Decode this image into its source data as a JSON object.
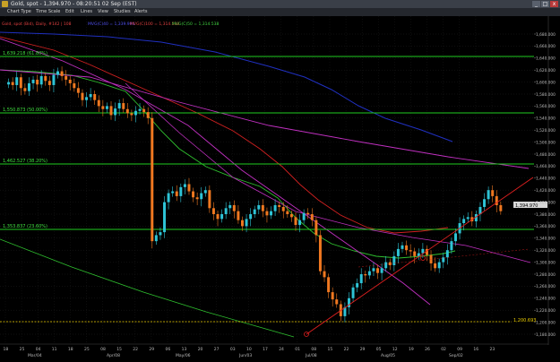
{
  "window": {
    "title": "Gold, spot - 1,394.970 - 08:20:51 02 Sep (EST)",
    "buttons": {
      "minimize": "_",
      "maximize": "□",
      "close": "x"
    }
  },
  "menu": [
    "Chart Type",
    "Time Scale",
    "Edit",
    "Lines",
    "View",
    "Studies",
    "Alerts"
  ],
  "legend": {
    "symbol": "Gold, spot (Bid), Daily, #142 | 108",
    "ma1": "MVG(C)40 = 1,339.994",
    "ma2": "MVG(C)100 = 1,314.538",
    "ma3": "MVG(C)50 = 1,314.538"
  },
  "colors": {
    "background": "#000000",
    "up": "#2ec4d6",
    "down": "#f07820",
    "fib": "#1fcc1f",
    "trend": "#e02020",
    "ma_red": "#d02020",
    "ma_green": "#2fc02f",
    "ma_blue": "#2030c0",
    "ma_magenta": "#c030c0",
    "yellow": "#f0d000"
  },
  "fib_labels": [
    "1,639.218 (61.80%)",
    "1,550.873 (50.00%)",
    "1,462.527 (38.20%)",
    "1,353.837 (23.60%)"
  ],
  "price_labels": {
    "current": "1,394.970",
    "yellow": "1,200.693"
  },
  "chart_data": {
    "type": "candlestick",
    "symbol": "Gold, spot",
    "y_ticks": [
      "1,680.000",
      "1,660.000",
      "1,640.000",
      "1,620.000",
      "1,600.000",
      "1,580.000",
      "1,560.000",
      "1,540.000",
      "1,520.000",
      "1,500.000",
      "1,480.000",
      "1,460.000",
      "1,440.000",
      "1,420.000",
      "1,400.000",
      "1,380.000",
      "1,360.000",
      "1,340.000",
      "1,320.000",
      "1,300.000",
      "1,280.000",
      "1,260.000",
      "1,240.000",
      "1,220.000",
      "1,200.000",
      "1,180.000"
    ],
    "x_ticks_days": [
      "18",
      "25",
      "04",
      "11",
      "18",
      "25",
      "08",
      "15",
      "22",
      "29",
      "06",
      "13",
      "20",
      "27",
      "03",
      "10",
      "17",
      "24",
      "01",
      "08",
      "15",
      "22",
      "29",
      "05",
      "12",
      "19",
      "26",
      "02",
      "09",
      "16",
      "23"
    ],
    "x_ticks_months": [
      "Mar/04",
      "Apr/08",
      "May/06",
      "Jun/03",
      "Jul/08",
      "Aug/05",
      "Sep/02"
    ],
    "ylim": [
      1170,
      1690
    ],
    "fib_levels": [
      1639.218,
      1550.873,
      1462.527,
      1353.837
    ],
    "current_price": 1394.97,
    "support_level": 1200.693,
    "closes": [
      1600,
      1595,
      1608,
      1590,
      1585,
      1598,
      1604,
      1596,
      1610,
      1602,
      1595,
      1612,
      1618,
      1610,
      1604,
      1598,
      1590,
      1582,
      1570,
      1575,
      1580,
      1570,
      1560,
      1555,
      1560,
      1545,
      1556,
      1565,
      1555,
      1548,
      1545,
      1552,
      1555,
      1550,
      1540,
      1335,
      1345,
      1350,
      1400,
      1415,
      1418,
      1410,
      1425,
      1430,
      1418,
      1408,
      1405,
      1415,
      1420,
      1390,
      1380,
      1372,
      1380,
      1390,
      1395,
      1385,
      1370,
      1360,
      1372,
      1380,
      1388,
      1395,
      1385,
      1378,
      1385,
      1395,
      1392,
      1385,
      1380,
      1375,
      1362,
      1370,
      1382,
      1380,
      1370,
      1345,
      1285,
      1275,
      1250,
      1238,
      1230,
      1210,
      1225,
      1240,
      1258,
      1265,
      1280,
      1278,
      1285,
      1290,
      1282,
      1290,
      1300,
      1295,
      1310,
      1322,
      1328,
      1320,
      1318,
      1310,
      1315,
      1322,
      1312,
      1298,
      1290,
      1300,
      1308,
      1320,
      1335,
      1348,
      1365,
      1372,
      1375,
      1368,
      1380,
      1392,
      1405,
      1420,
      1410,
      1395,
      1385
    ]
  }
}
